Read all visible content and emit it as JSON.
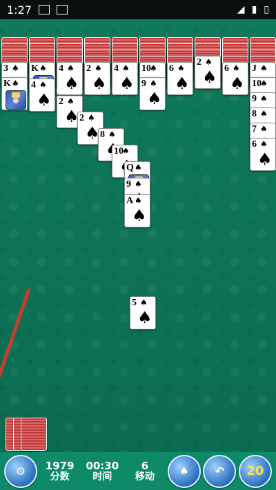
{
  "status": {
    "time": "1:27"
  },
  "board": {
    "columns": [
      {
        "name": "col1",
        "backs": 4,
        "cards": [
          {
            "rank": "3",
            "suit": "♠"
          },
          {
            "rank": "K",
            "suit": "♠"
          }
        ]
      },
      {
        "name": "col2",
        "backs": 4,
        "cards": [
          {
            "rank": "K",
            "suit": "♠"
          },
          {
            "rank": "4",
            "suit": "♠"
          },
          {
            "rank": "2",
            "suit": "♠"
          },
          {
            "rank": "2",
            "suit": "♠"
          },
          {
            "rank": "8",
            "suit": "♠"
          },
          {
            "rank": "10",
            "suit": "♠"
          },
          {
            "rank": "Q",
            "suit": "♠"
          },
          {
            "rank": "9",
            "suit": "♠"
          },
          {
            "rank": "A",
            "suit": "♠"
          }
        ]
      },
      {
        "name": "col3",
        "backs": 4,
        "cards": [
          {
            "rank": "4",
            "suit": "♠"
          }
        ]
      },
      {
        "name": "col4",
        "backs": 4,
        "cards": [
          {
            "rank": "2",
            "suit": "♠"
          }
        ]
      },
      {
        "name": "col5",
        "backs": 4,
        "cards": [
          {
            "rank": "4",
            "suit": "♠"
          }
        ]
      },
      {
        "name": "col6",
        "backs": 4,
        "cards": [
          {
            "rank": "10",
            "suit": "♠"
          },
          {
            "rank": "9",
            "suit": "♠"
          }
        ]
      },
      {
        "name": "col7",
        "backs": 4,
        "cards": [
          {
            "rank": "6",
            "suit": "♠"
          }
        ]
      },
      {
        "name": "col8",
        "backs": 3,
        "cards": [
          {
            "rank": "2",
            "suit": "♠"
          }
        ]
      },
      {
        "name": "col9",
        "backs": 4,
        "cards": [
          {
            "rank": "6",
            "suit": "♠"
          }
        ]
      },
      {
        "name": "col10",
        "backs": 4,
        "cards": [
          {
            "rank": "J",
            "suit": "♠"
          },
          {
            "rank": "10",
            "suit": "♠"
          },
          {
            "rank": "9",
            "suit": "♠"
          },
          {
            "rank": "8",
            "suit": "♠"
          },
          {
            "rank": "7",
            "suit": "♠"
          },
          {
            "rank": "6",
            "suit": "♠"
          }
        ]
      }
    ],
    "loose_card": {
      "rank": "5",
      "suit": "♠"
    }
  },
  "stats": {
    "score": "1979",
    "score_label": "分数",
    "time": "00:30",
    "time_label": "时间",
    "moves": "6",
    "moves_label": "移动"
  },
  "hint_count": "20"
}
